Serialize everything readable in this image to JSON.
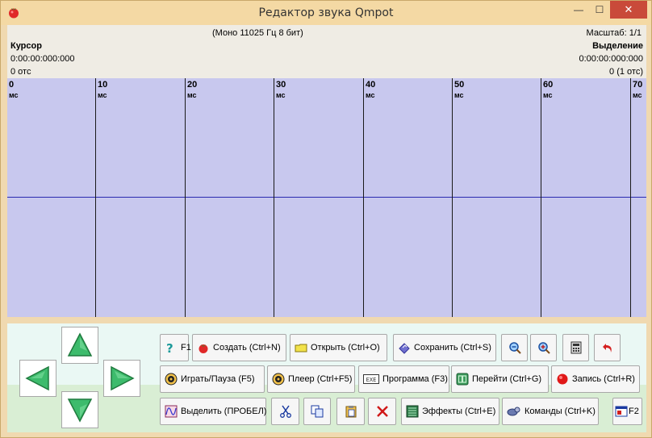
{
  "window": {
    "title": "Редактор звука Qmpot",
    "minimize_glyph": "—",
    "maximize_glyph": "☐",
    "close_glyph": "✕"
  },
  "info": {
    "format": "(Моно 11025 Гц 8 бит)",
    "scale": "Масштаб: 1/1",
    "cursor_label": "Курсор",
    "cursor_time": "0:00:00:000:000",
    "cursor_count": "0 отс",
    "selection_label": "Выделение",
    "selection_time": "0:00:00:000:000",
    "selection_count": "0 (1 отс)"
  },
  "wave": {
    "unit": "мс",
    "ticks": [
      "0",
      "10",
      "20",
      "30",
      "40",
      "50",
      "60",
      "70"
    ]
  },
  "toolbar": {
    "help": "F1",
    "create": "Создать (Ctrl+N)",
    "open": "Открыть (Ctrl+O)",
    "save": "Сохранить (Ctrl+S)",
    "play_pause": "Играть/Пауза (F5)",
    "player": "Плеер (Ctrl+F5)",
    "program": "Программа (F3)",
    "goto": "Перейти (Ctrl+G)",
    "record": "Запись (Ctrl+R)",
    "select": "Выделить (ПРОБЕЛ)",
    "effects": "Эффекты (Ctrl+E)",
    "commands": "Команды (Ctrl+K)",
    "f2": "F2",
    "program_icon_text": "EXE"
  },
  "colors": {
    "wave_bg": "#c8c8ee",
    "midline": "#2a2ab0",
    "arrow_green": "#3dbb6c",
    "close_red": "#c94a3a"
  }
}
